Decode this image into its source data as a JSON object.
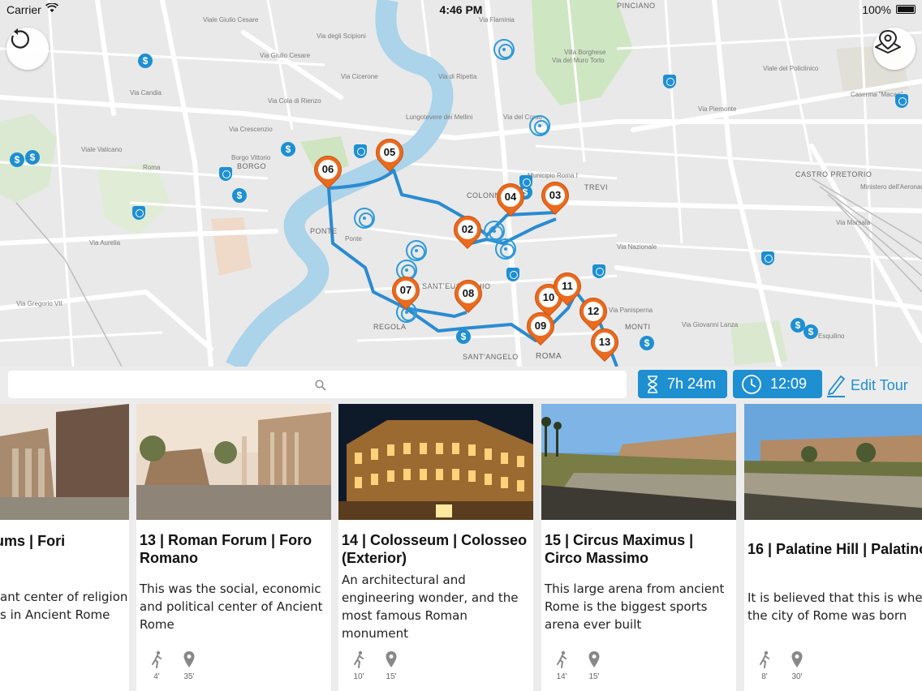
{
  "status_bar": {
    "carrier": "Carrier",
    "time": "4:46 PM",
    "battery": "100%"
  },
  "map": {
    "street_labels": [
      "Via Giulio Cesare",
      "Viale Giulio Cesare",
      "Via degli Scipioni",
      "Via Cola di Rienzo",
      "Via Crescenzio",
      "Borgo Vittorio",
      "BORGO",
      "Via Candia",
      "Viale Vaticano",
      "Via Aurelia",
      "Ponte",
      "PONTE",
      "REGOLA",
      "SANT'EUSTACHIO",
      "SANT'ANGELO",
      "ROMA",
      "COLONNA",
      "TREVI",
      "Municipio Roma I",
      "MONTI",
      "Via Giovanni Lanza",
      "CASTRO PRETORIO",
      "Via Marsala",
      "Via del Muro Torto",
      "Villa Borghese",
      "PINCIANO",
      "Caserma \"Macao\"",
      "Lungotevere dei Mellini",
      "Via Gregorio VII",
      "Via di Ripetta",
      "Via Nazionale",
      "Via Piemonte",
      "Via del Corso",
      "Roma",
      "Via Cicerone",
      "Via Flaminia",
      "Viale del Policlinico",
      "Ministero dell'Aeronautica",
      "Esquilino",
      "Via Panisperna"
    ],
    "route_color": "#2a8bd0",
    "pin_color": "#ea6a1e",
    "pins": [
      "06",
      "05",
      "04",
      "03",
      "02",
      "07",
      "08",
      "10",
      "11",
      "12",
      "09",
      "13"
    ],
    "poi_dollar_symbol": "$",
    "refresh_button_icon": "refresh-icon",
    "locate_button_icon": "map-location-icon"
  },
  "toolbar": {
    "search_placeholder": "",
    "duration": "7h 24m",
    "clock": "12:09",
    "edit_label": "Edit Tour",
    "accent": "#1e8fd1"
  },
  "cards": [
    {
      "title": "erial Forums | Fori",
      "desc": "ant center of religion s in Ancient Rome",
      "walk": "",
      "distance": ""
    },
    {
      "title": "13 | Roman Forum | Foro Romano",
      "desc": "This was the social, economic and political center of Ancient Rome",
      "walk": "4'",
      "distance": "35'"
    },
    {
      "title": "14 | Colosseum | Colosseo  (Exterior)",
      "desc": "An architectural and engineering wonder, and the most famous Roman monument",
      "walk": "10'",
      "distance": "15'"
    },
    {
      "title": "15 | Circus Maximus | Circo Massimo",
      "desc": "This large arena from ancient Rome is the biggest sports arena ever built",
      "walk": "14'",
      "distance": "15'"
    },
    {
      "title": "16 | Palatine Hill | Palatino",
      "desc": "It is believed that this is where the city of Rome was born",
      "walk": "8'",
      "distance": "30'"
    }
  ]
}
